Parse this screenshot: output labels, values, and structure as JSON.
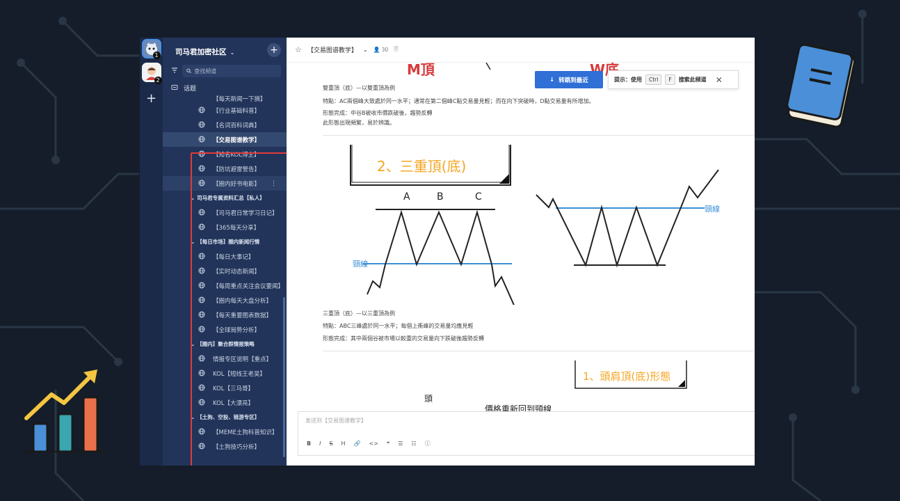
{
  "servers": [
    {
      "badge": "1"
    },
    {
      "badge": "2"
    }
  ],
  "server_add": "+",
  "sidebar": {
    "community_name": "司马君加密社区",
    "add_button": "+",
    "search_placeholder": "查找频道",
    "topic_label": "话题",
    "partial_item": "【每天新闻一下摘】",
    "groups": [
      {
        "category": "",
        "items": [
          "【行业基础科普】",
          "【名词百科词典】",
          "【交易图谱教学】",
          "【知名KOL博主】",
          "【防坑避雷警告】",
          "【圈内好书电影】"
        ]
      },
      {
        "category": "司马君专属资料汇总【私人】",
        "items": [
          "【司马君日常学习日记】",
          "【365每天分享】"
        ]
      },
      {
        "category": "【每日市场】圈内新闻行情",
        "items": [
          "【每日大事记】",
          "【实时动态新闻】",
          "【每周重点关注会议要闻】",
          "【圈内每天大盘分析】",
          "【每天重要图表数据】",
          "【全球局势分析】"
        ]
      },
      {
        "category": "【圈内】聚合群情报策略",
        "items": [
          "情报专区说明【重点】",
          "KOL【短线王老吴】",
          "KOL【三马哥】",
          "KOL【大漂亮】"
        ]
      },
      {
        "category": "【土狗、空投、链游专区】",
        "items": [
          "【MEME土狗科普知识】",
          "【土狗技巧分析】"
        ]
      }
    ],
    "active_item": "【交易图谱教学】",
    "hover_item": "【圈内好书电影】",
    "more_icon": "⋮"
  },
  "header": {
    "channel": "【交易图谱教学】",
    "members": "30"
  },
  "notice": {
    "jump_label": "转跳到最近",
    "hint_prefix": "提示：使用",
    "key1": "Ctrl",
    "key2": "F",
    "hint_suffix": "搜索此频道",
    "close": "✕"
  },
  "content": {
    "top_label_m": "M頂",
    "top_label_w": "W底",
    "double_title": "雙重頂（底）—以雙重頂為例",
    "double_feature": "特點：AC兩個峰大致處於同一水平；通常在第二個峰C點交易量見輕；而在向下突破時，D點交易量有所增加。",
    "double_complete": "形態完成：中谷B被收市價跌破後，趨勢反轉",
    "double_note": "此形態出現頻繁，易於辨識。",
    "triple_banner": "2、三重頂(底)",
    "peak_a": "A",
    "peak_b": "B",
    "peak_c": "C",
    "neckline_left": "頸線",
    "neckline_right": "頸線",
    "triple_title": "三重頂（底）—以三重頂為例",
    "triple_feature": "特點：ABC三峰處於同一水平；每個上衝峰的交易量均應見輕",
    "triple_complete": "形態完成：其中兩個谷被市場以較重的交易量向下跌破後趨勢反轉",
    "hs_banner": "1、頭肩頂(底)形態",
    "hs_head": "頭",
    "hs_caption": "價格重新回到頸線"
  },
  "composer": {
    "placeholder": "发送到【交易图谱教学】",
    "tools": [
      "B",
      "I",
      "S",
      "H",
      "🔗",
      "<>",
      "❝",
      "☰",
      "☷",
      "ⓘ"
    ]
  },
  "colors": {
    "sidebar_bg": "#22345a",
    "rail_bg": "#1b2a49",
    "accent_blue": "#2f6fd6",
    "outline_red": "#e23a3a",
    "banner_orange": "#f5a623",
    "neckline_blue": "#3a8fd6",
    "title_red": "#d63a3a"
  }
}
